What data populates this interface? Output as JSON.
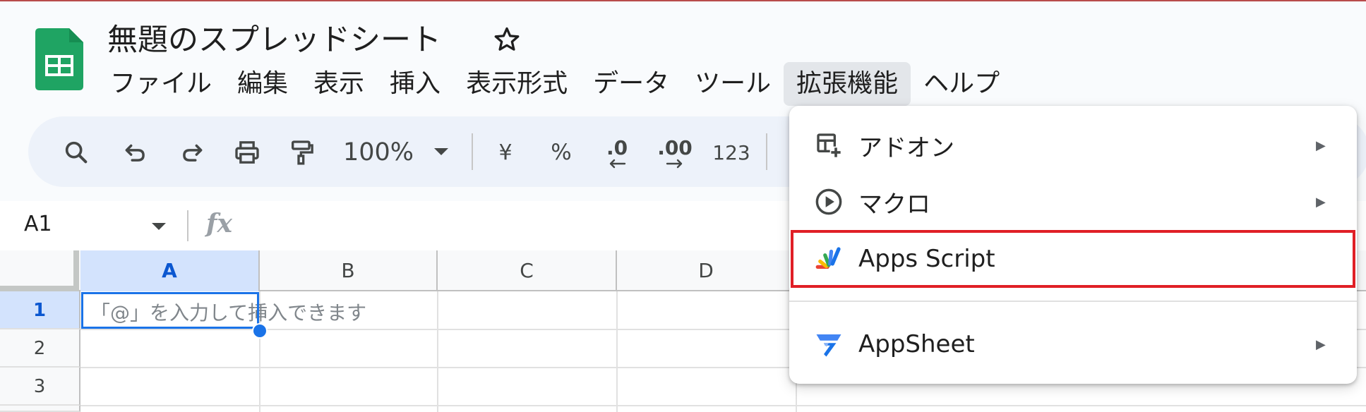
{
  "app": {
    "title": "無題のスプレッドシート"
  },
  "menubar": {
    "items": [
      "ファイル",
      "編集",
      "表示",
      "挿入",
      "表示形式",
      "データ",
      "ツール",
      "拡張機能",
      "ヘルプ"
    ],
    "active": "拡張機能"
  },
  "toolbar": {
    "zoom": "100%",
    "currency": "¥",
    "percent": "%",
    "decrease_decimal": ".0",
    "increase_decimal": ".00",
    "format_number": "123"
  },
  "formula_bar": {
    "name_box": "A1",
    "fx_label": "fx"
  },
  "grid": {
    "columns": [
      "A",
      "B",
      "C",
      "D"
    ],
    "rows": [
      "1",
      "2",
      "3"
    ],
    "selected_cell": "A1",
    "cell_hint": "「@」を入力して挿入できます"
  },
  "extensions_menu": {
    "items": [
      {
        "label": "アドオン",
        "icon": "addon-icon",
        "submenu": true
      },
      {
        "label": "マクロ",
        "icon": "macro-play-icon",
        "submenu": true
      },
      {
        "label": "Apps Script",
        "icon": "apps-script-icon",
        "submenu": false
      },
      {
        "label": "AppSheet",
        "icon": "appsheet-icon",
        "submenu": true
      }
    ],
    "highlighted": "Apps Script"
  },
  "colors": {
    "sheets_green": "#1fa463",
    "selection_blue": "#1a73e8",
    "highlight_red": "#e01f26",
    "toolbar_bg": "#edf2fa"
  }
}
